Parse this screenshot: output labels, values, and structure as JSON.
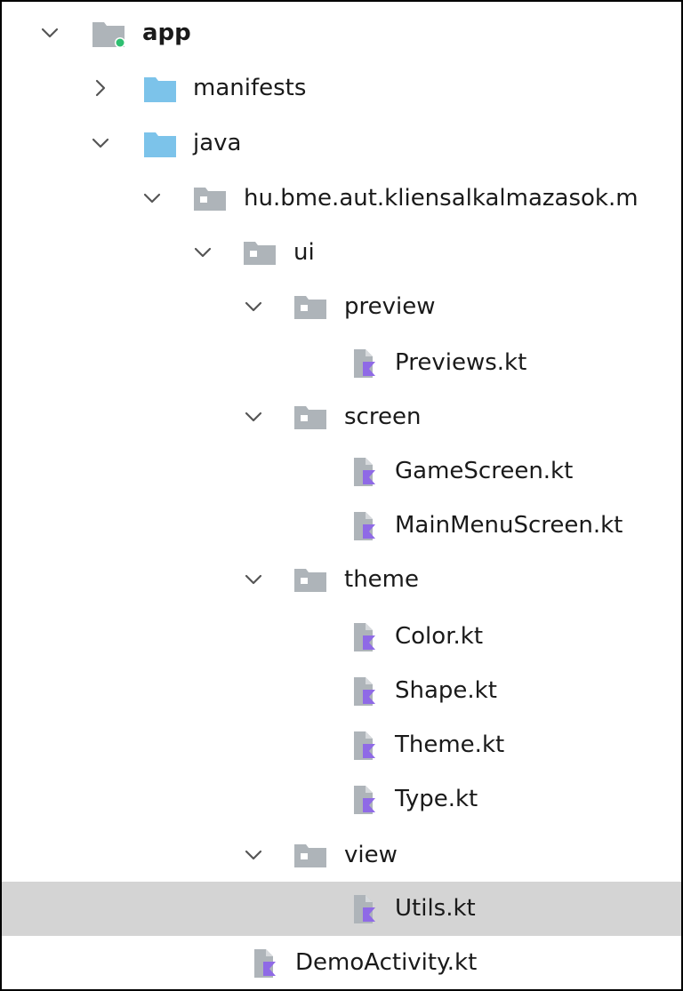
{
  "colors": {
    "folder_blue": "#7cc3ea",
    "folder_grey": "#aeb4b9",
    "module_dot": "#2fbf71",
    "kotlin_purple": "#8f6ae6",
    "selection": "#d4d4d4"
  },
  "tree": {
    "items": [
      {
        "label": "app",
        "expanded": true,
        "icon": "module-folder-icon",
        "bold": true
      },
      {
        "label": "manifests",
        "expanded": false,
        "icon": "folder-blue-icon"
      },
      {
        "label": "java",
        "expanded": true,
        "icon": "folder-blue-icon"
      },
      {
        "label": "hu.bme.aut.kliensalkalmazasok.m",
        "expanded": true,
        "icon": "package-icon"
      },
      {
        "label": "ui",
        "expanded": true,
        "icon": "package-icon"
      },
      {
        "label": "preview",
        "expanded": true,
        "icon": "package-icon"
      },
      {
        "label": "Previews.kt",
        "icon": "kotlin-file-icon"
      },
      {
        "label": "screen",
        "expanded": true,
        "icon": "package-icon"
      },
      {
        "label": "GameScreen.kt",
        "icon": "kotlin-file-icon"
      },
      {
        "label": "MainMenuScreen.kt",
        "icon": "kotlin-file-icon"
      },
      {
        "label": "theme",
        "expanded": true,
        "icon": "package-icon"
      },
      {
        "label": "Color.kt",
        "icon": "kotlin-file-icon"
      },
      {
        "label": "Shape.kt",
        "icon": "kotlin-file-icon"
      },
      {
        "label": "Theme.kt",
        "icon": "kotlin-file-icon"
      },
      {
        "label": "Type.kt",
        "icon": "kotlin-file-icon"
      },
      {
        "label": "view",
        "expanded": true,
        "icon": "package-icon"
      },
      {
        "label": "Utils.kt",
        "icon": "kotlin-file-icon",
        "selected": true
      },
      {
        "label": "DemoActivity.kt",
        "icon": "kotlin-file-icon"
      }
    ]
  }
}
